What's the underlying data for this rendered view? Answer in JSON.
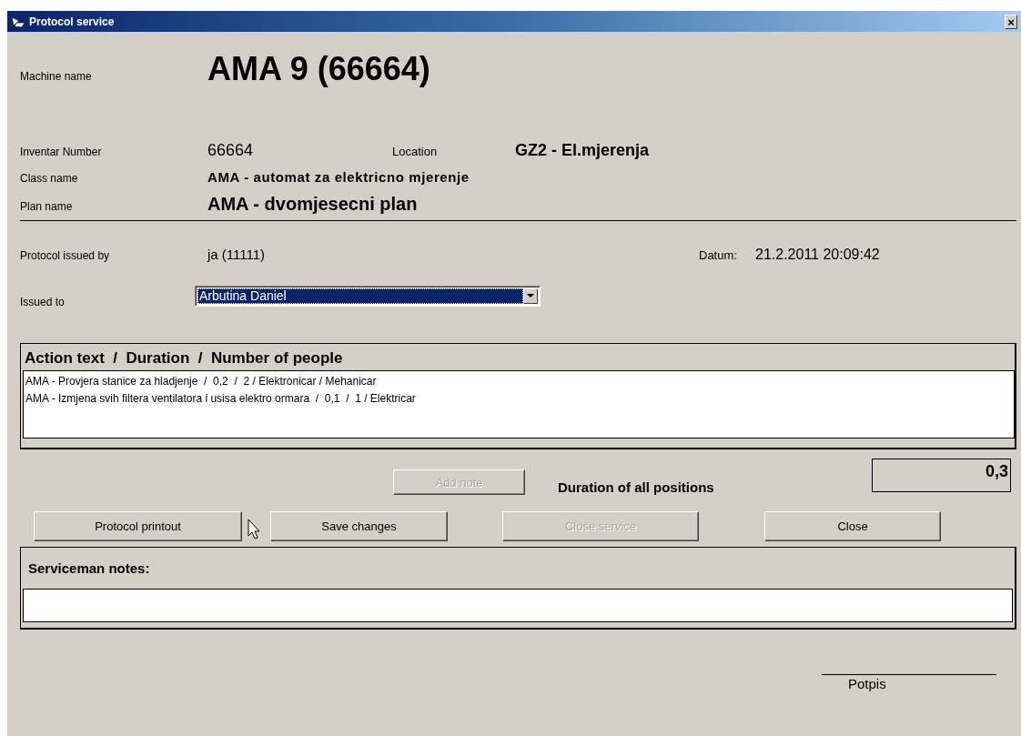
{
  "window": {
    "title": "Protocol service",
    "close": "×"
  },
  "machine": {
    "label": "Machine name",
    "value": "AMA 9 (66664)"
  },
  "inventar": {
    "label": "Inventar Number",
    "value": "66664"
  },
  "location": {
    "label": "Location",
    "value": "GZ2 - El.mjerenja"
  },
  "class_name": {
    "label": "Class name",
    "value": "AMA - automat za elektricno mjerenje"
  },
  "plan_name": {
    "label": "Plan name",
    "value": "AMA - dvomjesecni plan"
  },
  "issued_by": {
    "label": "Protocol issued by",
    "value": "ja (11111)"
  },
  "date": {
    "label": "Datum:",
    "value": "21.2.2011 20:09:42"
  },
  "issued_to": {
    "label": "Issued to",
    "value": "Arbutina Daniel",
    "selected": true
  },
  "actions": {
    "header": "Action text  /  Duration  /  Number of people",
    "rows": [
      {
        "text": "AMA - Provjera stanice za hladjenje  /  0,2  /  2 / Elektronicar / Mehanicar"
      },
      {
        "text": "AMA - Izmjena svih filtera ventilatora i usisa elektro ormara  /  0,1  /  1 / Elektricar"
      }
    ]
  },
  "add_note": {
    "label": "Add note",
    "disabled": true
  },
  "duration": {
    "label": "Duration of all positions",
    "value": "0,3"
  },
  "buttons": [
    {
      "label": "Protocol printout",
      "disabled": false
    },
    {
      "label": "Save changes",
      "disabled": false
    },
    {
      "label": "Close service",
      "disabled": true
    },
    {
      "label": "Close",
      "disabled": false
    }
  ],
  "notes": {
    "label": "Serviceman notes:"
  },
  "signature": {
    "label": "Potpis"
  }
}
